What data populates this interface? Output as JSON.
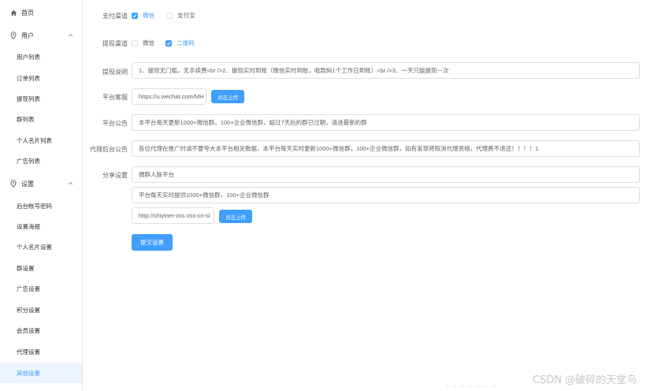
{
  "sidebar": {
    "home": "首页",
    "user_group": "用户",
    "user_items": [
      "用户列表",
      "订单列表",
      "提现列表",
      "群列表",
      "个人名片列表",
      "广告列表"
    ],
    "settings_group": "设置",
    "settings_items": [
      "后台帐号密码",
      "设置海报",
      "个人名片设置",
      "群设置",
      "广告设置",
      "积分设置",
      "会员设置",
      "代理设置",
      "其他设置"
    ]
  },
  "form": {
    "pay_channel_label": "支付渠道",
    "pay_wechat": "微信",
    "pay_alipay": "支付宝",
    "withdraw_channel_label": "提现渠道",
    "withdraw_wechat": "微信",
    "withdraw_qrcode": "二维码",
    "withdraw_desc_label": "提现说明",
    "withdraw_desc_value": "1、提现无门槛，无手续费<br />2、提现实时到账（微信实时到账，收款码1个工作日到账）<br />3、一天只能提现一次",
    "service_label": "平台客服",
    "service_value": "https://u.wechat.com/MH",
    "upload_btn": "点击上传",
    "notice_label": "平台公告",
    "notice_value": "本平台每天更新1000+微信群，100+企业微信群，超过7天后的群已过期，请进最新的群",
    "agent_notice_label": "代理后台公告",
    "agent_notice_value": "各位代理在推广时请不要夸大本平台相关数据，本平台每天实时更新1000+微信群，100+企业微信群，如有发现将取消代理资格，代理费不退还！！！！1",
    "share_label": "分享设置",
    "share_title": "微群人脉平台",
    "share_desc": "平台每天实时提供1000+微信群，100+企业微信群",
    "share_image": "http://shiyinet-oss.oss-cn-sl",
    "upload_btn2": "点击上传",
    "submit": "提交设置"
  },
  "watermark": "CSDN @破碎的天堂鸟",
  "colors": {
    "accent": "#409eff",
    "active_bg": "#ecf5ff",
    "border": "#dcdfe6"
  }
}
